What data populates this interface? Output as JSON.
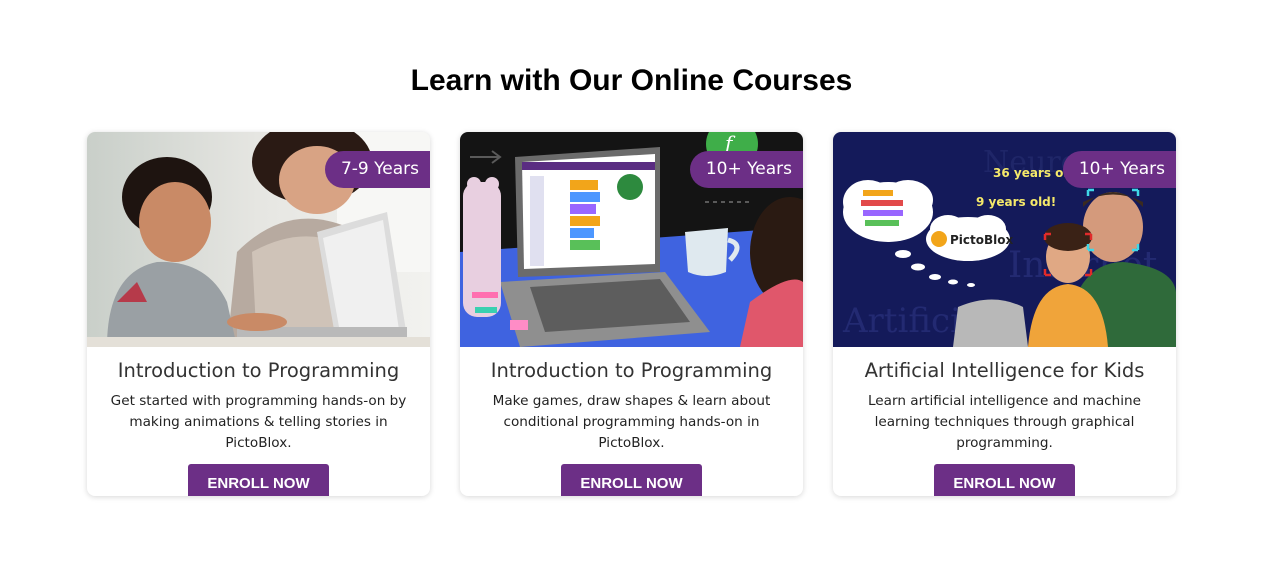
{
  "section": {
    "title": "Learn with Our Online Courses"
  },
  "courses": [
    {
      "age": "7-9 Years",
      "title": "Introduction to Programming",
      "description": "Get started with programming hands-on by making animations & telling stories in PictoBlox.",
      "button": "ENROLL NOW"
    },
    {
      "age": "10+ Years",
      "title": "Introduction to Programming",
      "description": "Make games, draw shapes & learn about conditional programming hands-on in PictoBlox.",
      "button": "ENROLL NOW"
    },
    {
      "age": "10+ Years",
      "title": "Artificial Intelligence for Kids",
      "description": "Learn artificial intelligence and machine learning techniques through graphical programming.",
      "button": "ENROLL NOW",
      "image_text": {
        "age_label_1": "36 years old!",
        "age_label_2": "9 years old!",
        "brand": "PictoBlox"
      }
    }
  ],
  "colors": {
    "accent": "#6c2f86",
    "title": "#000000",
    "card_title": "#333333"
  }
}
